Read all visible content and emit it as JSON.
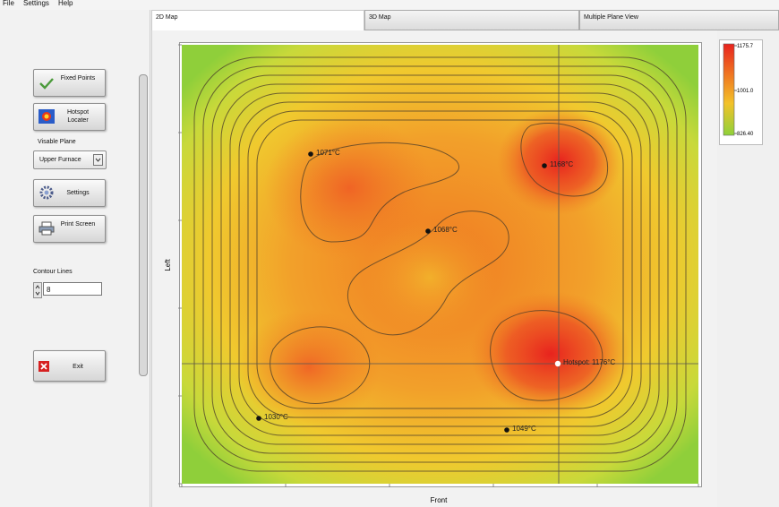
{
  "menu": {
    "file": "File",
    "settings": "Settings",
    "help": "Help"
  },
  "tabs": [
    {
      "label": "2D Map",
      "active": true
    },
    {
      "label": "3D Map",
      "active": false
    },
    {
      "label": "Multiple Plane View",
      "active": false
    }
  ],
  "sidebar": {
    "fixed_points_label": "Fixed Points",
    "hotspot_locater_label": "Hotspot Locater",
    "visable_plane_label": "Visable Plane",
    "plane_select_value": "Upper Furnace",
    "settings_label": "Settings",
    "print_screen_label": "Print Screen",
    "contour_lines_label": "Contour Lines",
    "contour_lines_value": "8",
    "exit_label": "Exit"
  },
  "icons": {
    "fixed_points": "checkmark-icon",
    "hotspot_locater": "heatmap-icon",
    "settings": "gear-icon",
    "print_screen": "printer-icon",
    "exit": "close-icon",
    "dropdown": "chevron-down-icon",
    "stepper": "up-down-arrows-icon"
  },
  "chart_data": {
    "type": "heatmap",
    "xlabel": "Front",
    "ylabel": "Left",
    "colorbar": {
      "max": "1175.7",
      "mid": "1001.0",
      "min": "826.40"
    },
    "colors": {
      "low": "#8fd13a",
      "mid": "#f2c22a",
      "high": "#e8231e"
    },
    "contour_count": 8,
    "crosshair": true,
    "points": [
      {
        "label": "1071°C",
        "value": 1071
      },
      {
        "label": "1168°C",
        "value": 1168
      },
      {
        "label": "1068°C",
        "value": 1068
      },
      {
        "label": "Hotspot: 1176°C",
        "value": 1176,
        "hotspot": true
      },
      {
        "label": "1030°C",
        "value": 1030
      },
      {
        "label": "1049°C",
        "value": 1049
      }
    ]
  }
}
